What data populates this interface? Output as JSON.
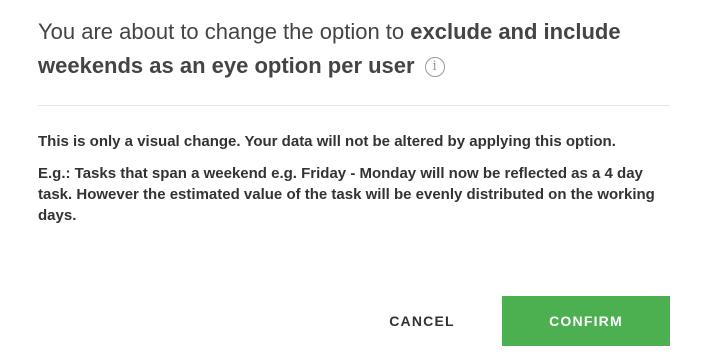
{
  "dialog": {
    "title_prefix": "You are about to change the option to ",
    "title_bold": "exclude and include weekends as an eye option per user",
    "info_icon": "info-icon",
    "info_glyph": "i",
    "paragraph_1": "This is only a visual change. Your data will not be altered by applying this option.",
    "paragraph_2": "E.g.: Tasks that span a weekend e.g. Friday - Monday will now be reflected as a 4 day task. However the estimated value of the task will be evenly distributed on the working days."
  },
  "actions": {
    "cancel_label": "CANCEL",
    "confirm_label": "CONFIRM"
  },
  "colors": {
    "confirm_bg": "#4caf50",
    "text": "#333333",
    "divider": "#e6e6e6"
  }
}
